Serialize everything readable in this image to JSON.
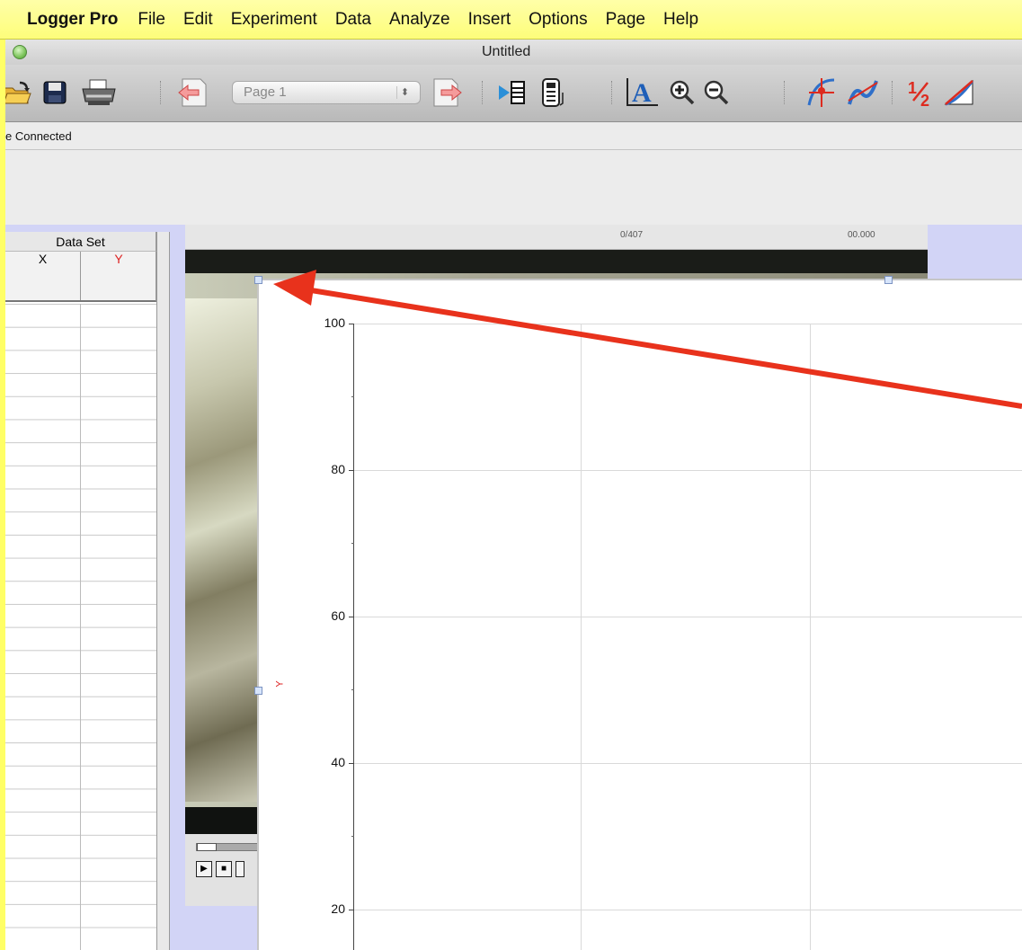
{
  "menubar": {
    "app": "Logger Pro",
    "items": [
      "File",
      "Edit",
      "Experiment",
      "Data",
      "Analyze",
      "Insert",
      "Options",
      "Page",
      "Help"
    ]
  },
  "window": {
    "title": "Untitled"
  },
  "toolbar": {
    "page_selector": "Page 1",
    "icons": [
      "open-file-icon",
      "save-icon",
      "print-icon",
      "page-back-icon",
      "page-forward-icon",
      "insert-movie-icon",
      "calculator-icon",
      "autoscale-icon",
      "zoom-in-icon",
      "zoom-out-icon",
      "examine-icon",
      "tangent-icon",
      "integral-icon",
      "slope-icon"
    ]
  },
  "status": {
    "text": "e Connected"
  },
  "table": {
    "dataset": "Data Set",
    "columns": [
      "X",
      "Y"
    ]
  },
  "movie": {
    "frame": "0/407",
    "time": "00.000"
  },
  "graph": {
    "y_tick_labels": [
      "100",
      "80",
      "60",
      "40",
      "20"
    ],
    "y_axis_label": "Y"
  },
  "colors": {
    "background_highlight": "#ffff66",
    "workspace": "#d2d4f6",
    "annotation_arrow": "#e8321c",
    "axis_label": "#dd2222"
  }
}
